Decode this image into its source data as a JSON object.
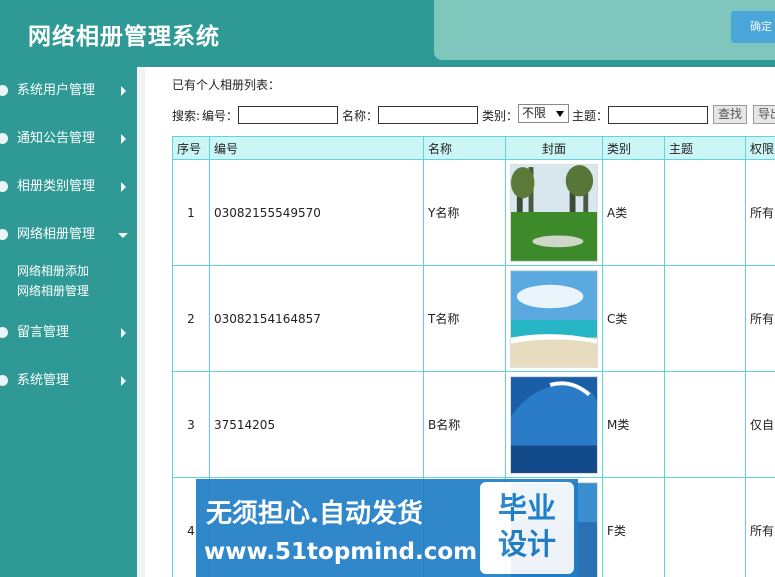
{
  "header": {
    "app_title": "网络相册管理系统",
    "top_button_label": "确定"
  },
  "sidebar": {
    "items": [
      {
        "label": "系统用户管理",
        "icon": "user-icon",
        "expanded": false
      },
      {
        "label": "通知公告管理",
        "icon": "gear-icon",
        "expanded": false
      },
      {
        "label": "相册类别管理",
        "icon": "download-icon",
        "expanded": false
      },
      {
        "label": "网络相册管理",
        "icon": "picture-icon",
        "expanded": true
      },
      {
        "label": "留言管理",
        "icon": "chat-icon",
        "expanded": false
      },
      {
        "label": "系统管理",
        "icon": "settings-icon",
        "expanded": false
      }
    ],
    "subitems": [
      "网络相册添加",
      "网络相册管理"
    ]
  },
  "main": {
    "list_title": "已有个人相册列表：",
    "search": {
      "prefix": "搜索:",
      "number_label": "编号：",
      "name_label": "名称：",
      "category_label": "类别：",
      "category_selected": "不限",
      "topic_label": "主题：",
      "search_button": "查找",
      "export_button": "导出"
    },
    "table": {
      "headers": [
        "序号",
        "编号",
        "名称",
        "封面",
        "类别",
        "主题",
        "权限"
      ],
      "rows": [
        {
          "index": "1",
          "number": "03082155549570",
          "name": "Y名称",
          "category": "A类",
          "topic": "",
          "permission": "所有人"
        },
        {
          "index": "2",
          "number": "03082154164857",
          "name": "T名称",
          "category": "C类",
          "topic": "",
          "permission": "所有人"
        },
        {
          "index": "3",
          "number": "37514205",
          "name": "B名称",
          "category": "M类",
          "topic": "",
          "permission": "仅自己"
        },
        {
          "index": "4",
          "number": "",
          "name": "",
          "category": "F类",
          "topic": "",
          "permission": "所有人"
        }
      ]
    }
  },
  "watermark": {
    "line1": "无须担心.自动发货",
    "line2": "www.51topmind.com",
    "badge_line1": "毕业",
    "badge_line2": "设计"
  },
  "colors": {
    "teal": "#2f9a95",
    "header_panel": "#7fc6bd",
    "table_border": "#5fd3de",
    "table_header_bg": "#ccf6f6",
    "watermark_blue": "#1f7ec7"
  }
}
